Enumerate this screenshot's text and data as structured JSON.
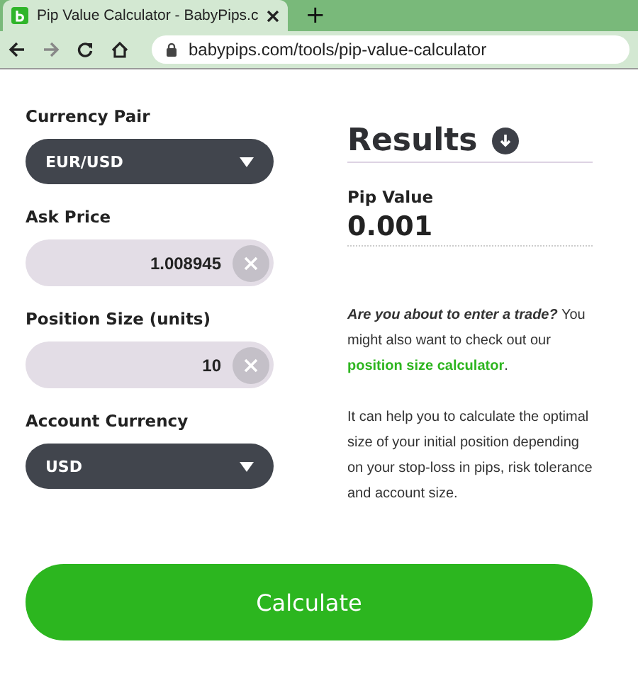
{
  "browser": {
    "tab_title": "Pip Value Calculator - BabyPips.c",
    "new_tab": "+",
    "url": "babypips.com/tools/pip-value-calculator"
  },
  "form": [
    {
      "kind": "select",
      "label": "Currency Pair",
      "value": "EUR/USD"
    },
    {
      "kind": "input",
      "label": "Ask Price",
      "value": "1.008945"
    },
    {
      "kind": "input",
      "label": "Position Size (units)",
      "value": "10"
    },
    {
      "kind": "select",
      "label": "Account Currency",
      "value": "USD"
    }
  ],
  "results": {
    "title": "Results",
    "pip_label": "Pip Value",
    "pip_value": "0.001"
  },
  "promo": {
    "lead": "Are you about to enter a trade?",
    "text": "You might also want to check out our",
    "link": "position size calculator",
    "tail": "."
  },
  "note": "It can help you to calculate the optimal size of your initial position depending on your stop-loss in pips, risk tolerance and account size.",
  "button": "Calculate"
}
